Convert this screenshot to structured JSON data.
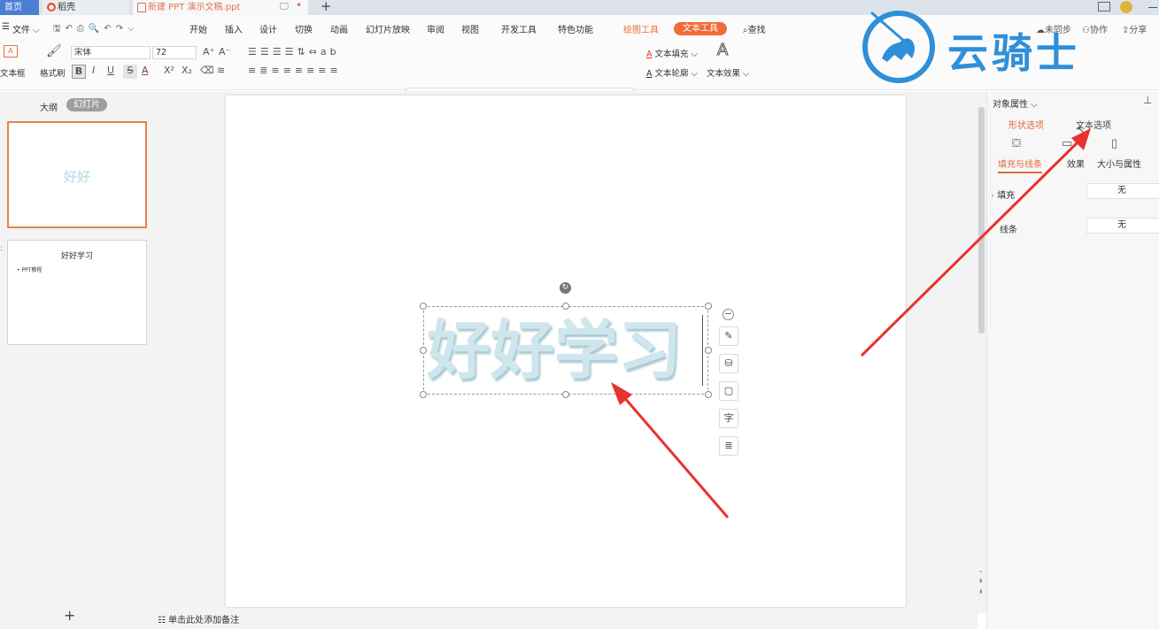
{
  "tabs": {
    "home": "首页",
    "daoke": "稻壳",
    "doc": "新建 PPT 演示文稿.ppt",
    "new_tab": "+"
  },
  "menu": {
    "file": "文件",
    "items": [
      "开始",
      "插入",
      "设计",
      "切换",
      "动画",
      "幻灯片放映",
      "审阅",
      "视图",
      "开发工具",
      "特色功能"
    ],
    "drawing_tools": "绘图工具",
    "text_tools": "文本工具",
    "search": "查找",
    "unsync": "未同步",
    "collab": "协作",
    "share": "分享"
  },
  "ribbon": {
    "textbox": "文本框",
    "format_painter": "格式刷",
    "font_name": "宋体",
    "font_size": "72",
    "text_fill": "文本填充",
    "text_outline": "文本轮廓",
    "text_effect": "文本效果",
    "wordart_glyph": "A",
    "wordart_effect_glyph": "A"
  },
  "watermark": {
    "text": "云骑士"
  },
  "left": {
    "outline": "大纲",
    "slides": "幻灯片",
    "thumb1_text": "好好",
    "thumb2_title": "好好学习",
    "thumb2_bullet": "• PPT教程",
    "add": "+"
  },
  "slide": {
    "text": "好好学习"
  },
  "float_tools": {
    "text_char": "字"
  },
  "notes": {
    "placeholder": "单击此处添加备注"
  },
  "right": {
    "title": "对象属性",
    "tab_shape": "形状选项",
    "tab_text": "文本选项",
    "sub_fill": "填充与线条",
    "sub_effect": "效果",
    "sub_size": "大小与属性",
    "fill_label": "填充",
    "fill_value": "无",
    "line_label": "线条",
    "line_value": "无"
  },
  "colors": {
    "accent": "#ef6c38",
    "tab_active": "#4a7fd4",
    "arrow": "#e8322e",
    "watermark": "#2f8fd8"
  }
}
